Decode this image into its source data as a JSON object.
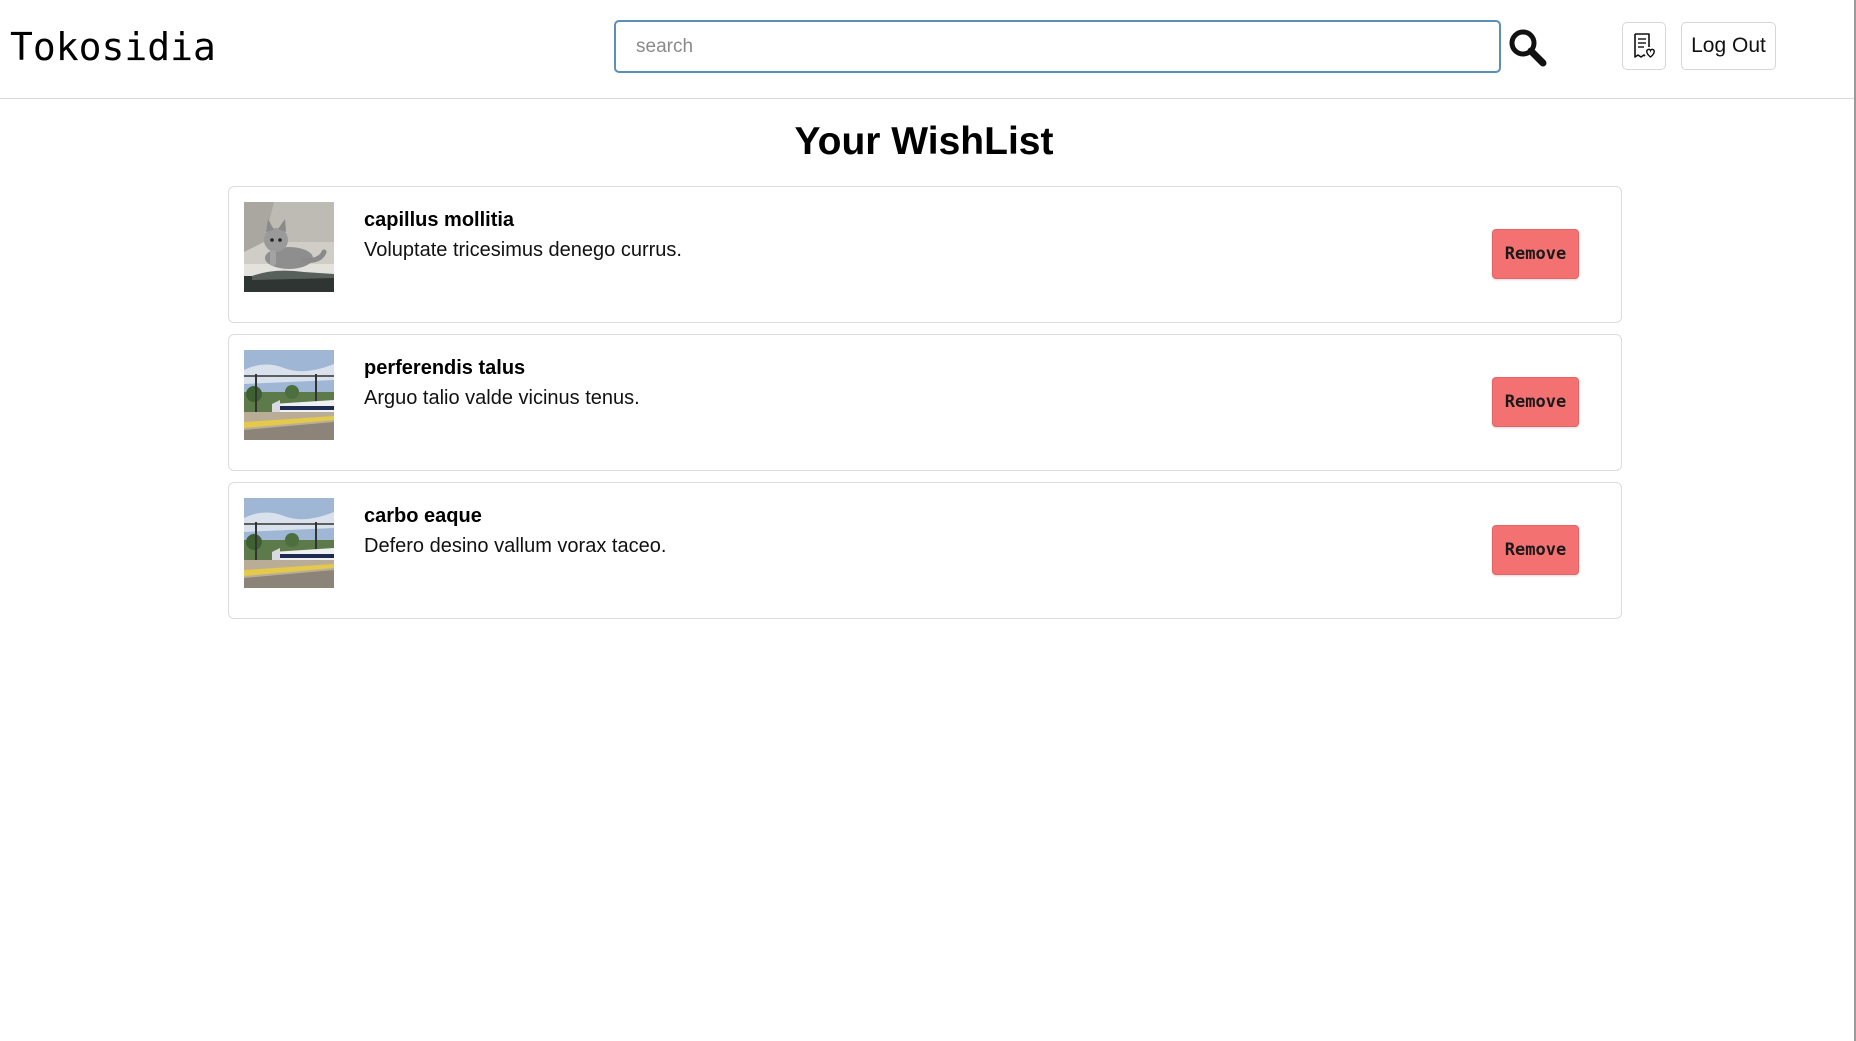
{
  "header": {
    "brand": "Tokosidia",
    "search": {
      "placeholder": "search",
      "value": ""
    },
    "search_icon": "magnifier-icon",
    "wishlist_icon": "wishlist-receipt-icon",
    "logout_label": "Log Out"
  },
  "page": {
    "title": "Your WishList"
  },
  "wishlist": {
    "items": [
      {
        "name": "capillus mollitia",
        "description": "Voluptate tricesimus denego currus.",
        "image": "cat-photo",
        "remove_label": "Remove"
      },
      {
        "name": "perferendis talus",
        "description": "Arguo talio valde vicinus tenus.",
        "image": "train-station-photo",
        "remove_label": "Remove"
      },
      {
        "name": "carbo eaque",
        "description": "Defero desino vallum vorax taceo.",
        "image": "train-station-photo",
        "remove_label": "Remove"
      }
    ]
  },
  "colors": {
    "remove_button": "#f47171",
    "search_border": "#5b8fb9",
    "card_border": "#dcdcdc"
  }
}
